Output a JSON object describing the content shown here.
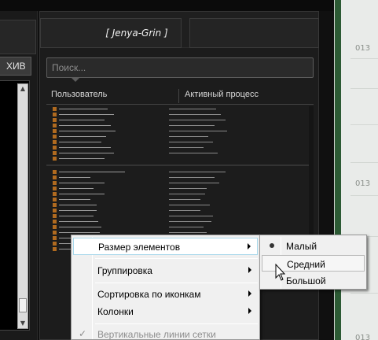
{
  "left_panel": {
    "tab_label": "ХИВ"
  },
  "header": {
    "title": "[ Jenya-Grin ]"
  },
  "search": {
    "placeholder": "Поиск..."
  },
  "columns": {
    "user": "Пользователь",
    "process": "Активный процесс"
  },
  "context_menu": {
    "items": [
      {
        "label": "Размер элементов",
        "submenu": true,
        "highlighted": true
      },
      {
        "label": "Группировка",
        "submenu": true
      },
      {
        "label": "Сортировка по иконкам",
        "submenu": true
      },
      {
        "label": "Колонки",
        "submenu": true
      },
      {
        "label": "Вертикальные линии сетки",
        "checked": true,
        "disabled": true
      }
    ]
  },
  "submenu": {
    "items": [
      {
        "label": "Малый",
        "selected": true
      },
      {
        "label": "Средний",
        "hovered": true
      },
      {
        "label": "Большой"
      }
    ]
  },
  "background_window": {
    "numbers": [
      "013",
      "013",
      "013"
    ]
  }
}
